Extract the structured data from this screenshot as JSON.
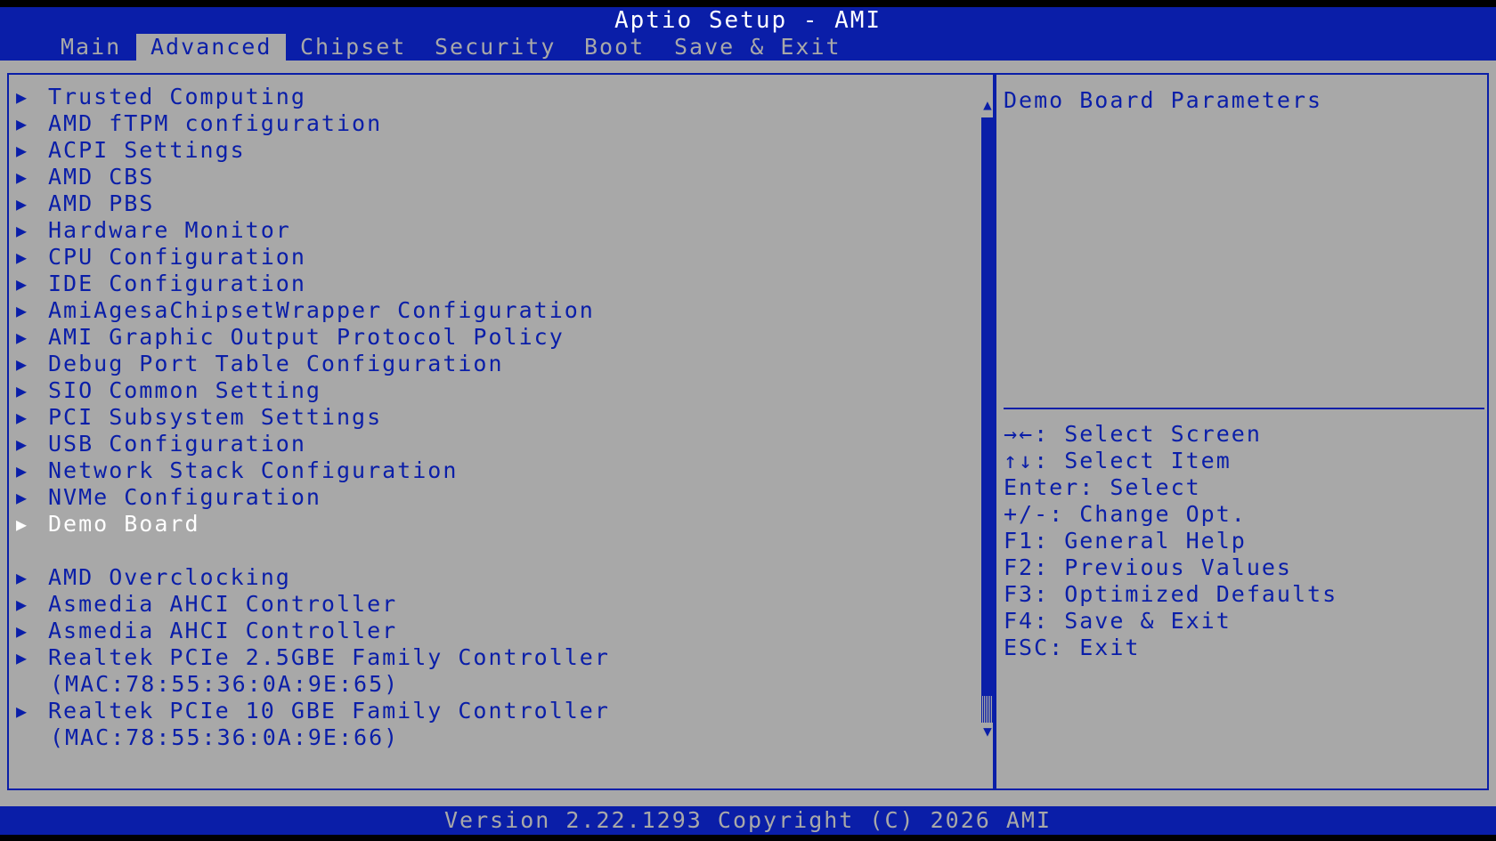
{
  "title": "Aptio Setup - AMI",
  "tabs": [
    {
      "label": "Main"
    },
    {
      "label": "Advanced"
    },
    {
      "label": "Chipset"
    },
    {
      "label": "Security"
    },
    {
      "label": "Boot"
    },
    {
      "label": "Save & Exit"
    }
  ],
  "active_tab": "Advanced",
  "menu": {
    "arrow_glyph": "▶",
    "items": [
      {
        "label": "Trusted Computing"
      },
      {
        "label": "AMD fTPM configuration"
      },
      {
        "label": "ACPI Settings"
      },
      {
        "label": "AMD CBS"
      },
      {
        "label": "AMD PBS"
      },
      {
        "label": "Hardware Monitor"
      },
      {
        "label": "CPU Configuration"
      },
      {
        "label": "IDE Configuration"
      },
      {
        "label": "AmiAgesaChipsetWrapper Configuration"
      },
      {
        "label": "AMI Graphic Output Protocol Policy"
      },
      {
        "label": "Debug Port Table Configuration"
      },
      {
        "label": "SIO Common Setting"
      },
      {
        "label": "PCI Subsystem Settings"
      },
      {
        "label": "USB Configuration"
      },
      {
        "label": "Network Stack Configuration"
      },
      {
        "label": "NVMe Configuration"
      },
      {
        "label": "Demo Board"
      },
      {
        "label": "AMD Overclocking"
      },
      {
        "label": "Asmedia AHCI Controller"
      },
      {
        "label": "Asmedia AHCI Controller"
      },
      {
        "label": "Realtek PCIe 2.5GBE Family Controller",
        "detail": "(MAC:78:55:36:0A:9E:65)"
      },
      {
        "label": "Realtek PCIe 10 GBE Family Controller",
        "detail": "(MAC:78:55:36:0A:9E:66)"
      }
    ],
    "selected_label": "Demo Board"
  },
  "scrollbar": {
    "up": "▲",
    "down": "▼"
  },
  "help": {
    "description": "Demo Board Parameters",
    "keys": [
      "→←: Select Screen",
      "↑↓: Select Item",
      "Enter: Select",
      "+/-: Change Opt.",
      "F1: General Help",
      "F2: Previous Values",
      "F3: Optimized Defaults",
      "F4: Save & Exit",
      "ESC: Exit"
    ]
  },
  "footer": "Version 2.22.1293 Copyright (C) 2026 AMI",
  "colors": {
    "blue": "#0a1ea8",
    "gray": "#a8a8a8",
    "white": "#ffffff",
    "black": "#000000"
  }
}
